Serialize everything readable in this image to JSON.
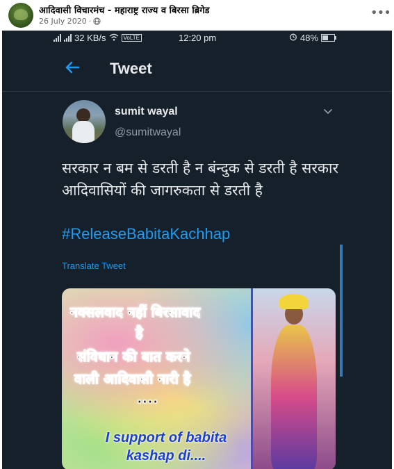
{
  "post": {
    "page_name": "आदिवासी विचारमंच - महाराष्ट्र राज्य व बिरसा ब्रिगेड",
    "date": "26 July 2020",
    "privacy_icon": "globe-icon",
    "more_icon": "more-dots-icon"
  },
  "status_bar": {
    "speed": "32 KB/s",
    "volte": "VoLTE",
    "time": "12:20 pm",
    "battery": "48%"
  },
  "tweet_view": {
    "header_title": "Tweet",
    "back_icon": "arrow-left-icon"
  },
  "tweet": {
    "display_name": "sumit wayal",
    "handle": "@sumitwayal",
    "text": "सरकार न बम से डरती है न बंन्दुक से डरती है सरकार आदिवासियों की जागरुकता से डरती है",
    "hashtag": "#ReleaseBabitaKachhap",
    "translate_label": "Translate Tweet",
    "accent_color": "#1d9bf0"
  },
  "media": {
    "line1": "नक्सलवाद नहीं बिरसावाद",
    "line2": "है",
    "line3": "संविधान की बात करने",
    "line4": "वाली आदिवासी नारी है",
    "line5": "....",
    "support_text": "I support of babita kashap di...."
  }
}
